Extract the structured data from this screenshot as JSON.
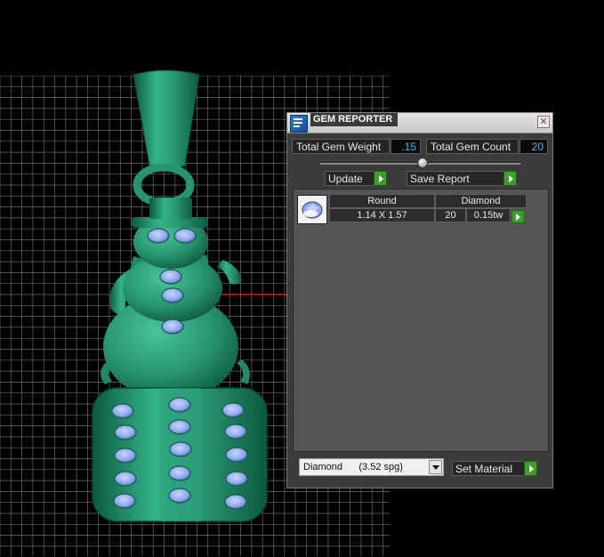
{
  "viewport": {
    "grid_color": "#6a6a6a",
    "model_color": "#2a9a76",
    "gem_color": "#8ea8f0",
    "axis_color": "#d22222"
  },
  "panel": {
    "title": "GEM REPORTER",
    "title_icon": "app-icon",
    "close_icon": "close-icon",
    "total_gem_weight_label": "Total Gem Weight",
    "total_gem_weight_value": ".15",
    "total_gem_count_label": "Total Gem Count",
    "total_gem_count_value": "20",
    "update_label": "Update",
    "save_report_label": "Save Report",
    "accent_green": "#3f9d2c",
    "value_color": "#4ab8f5",
    "report": {
      "rows": [
        {
          "icon": "round-gem-icon",
          "shape": "Round",
          "material": "Diamond",
          "size": "1.14 X 1.57",
          "count": "20",
          "weight": "0.15tw"
        }
      ]
    },
    "material_select": "Diamond      (3.52 spg)",
    "set_material_label": "Set Material"
  }
}
